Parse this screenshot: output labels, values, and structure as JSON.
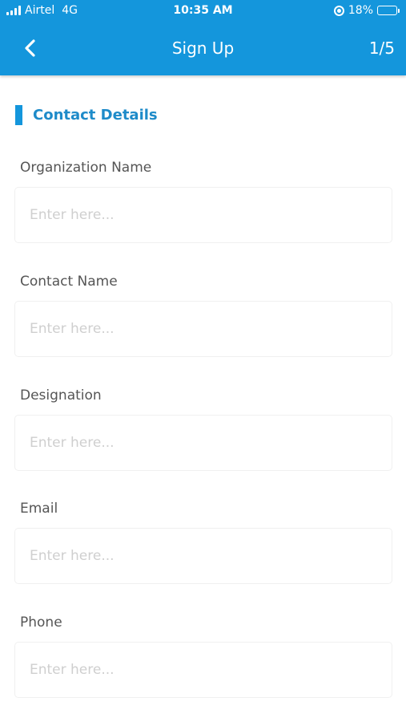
{
  "status_bar": {
    "carrier": "Airtel",
    "network": "4G",
    "time": "10:35 AM",
    "battery": "18%",
    "battery_level": 0.18,
    "battery_color": "#d9e021"
  },
  "header": {
    "back_icon": "chevron-left-icon",
    "title": "Sign Up",
    "step": "1/5",
    "background": "#1496dc"
  },
  "section": {
    "title": "Contact Details",
    "accent": "#1496dc"
  },
  "fields": [
    {
      "label": "Organization Name",
      "placeholder": "Enter here...",
      "value": ""
    },
    {
      "label": "Contact Name",
      "placeholder": "Enter here...",
      "value": ""
    },
    {
      "label": "Designation",
      "placeholder": "Enter here...",
      "value": ""
    },
    {
      "label": "Email",
      "placeholder": "Enter here...",
      "value": ""
    },
    {
      "label": "Phone",
      "placeholder": "Enter here...",
      "value": ""
    }
  ]
}
